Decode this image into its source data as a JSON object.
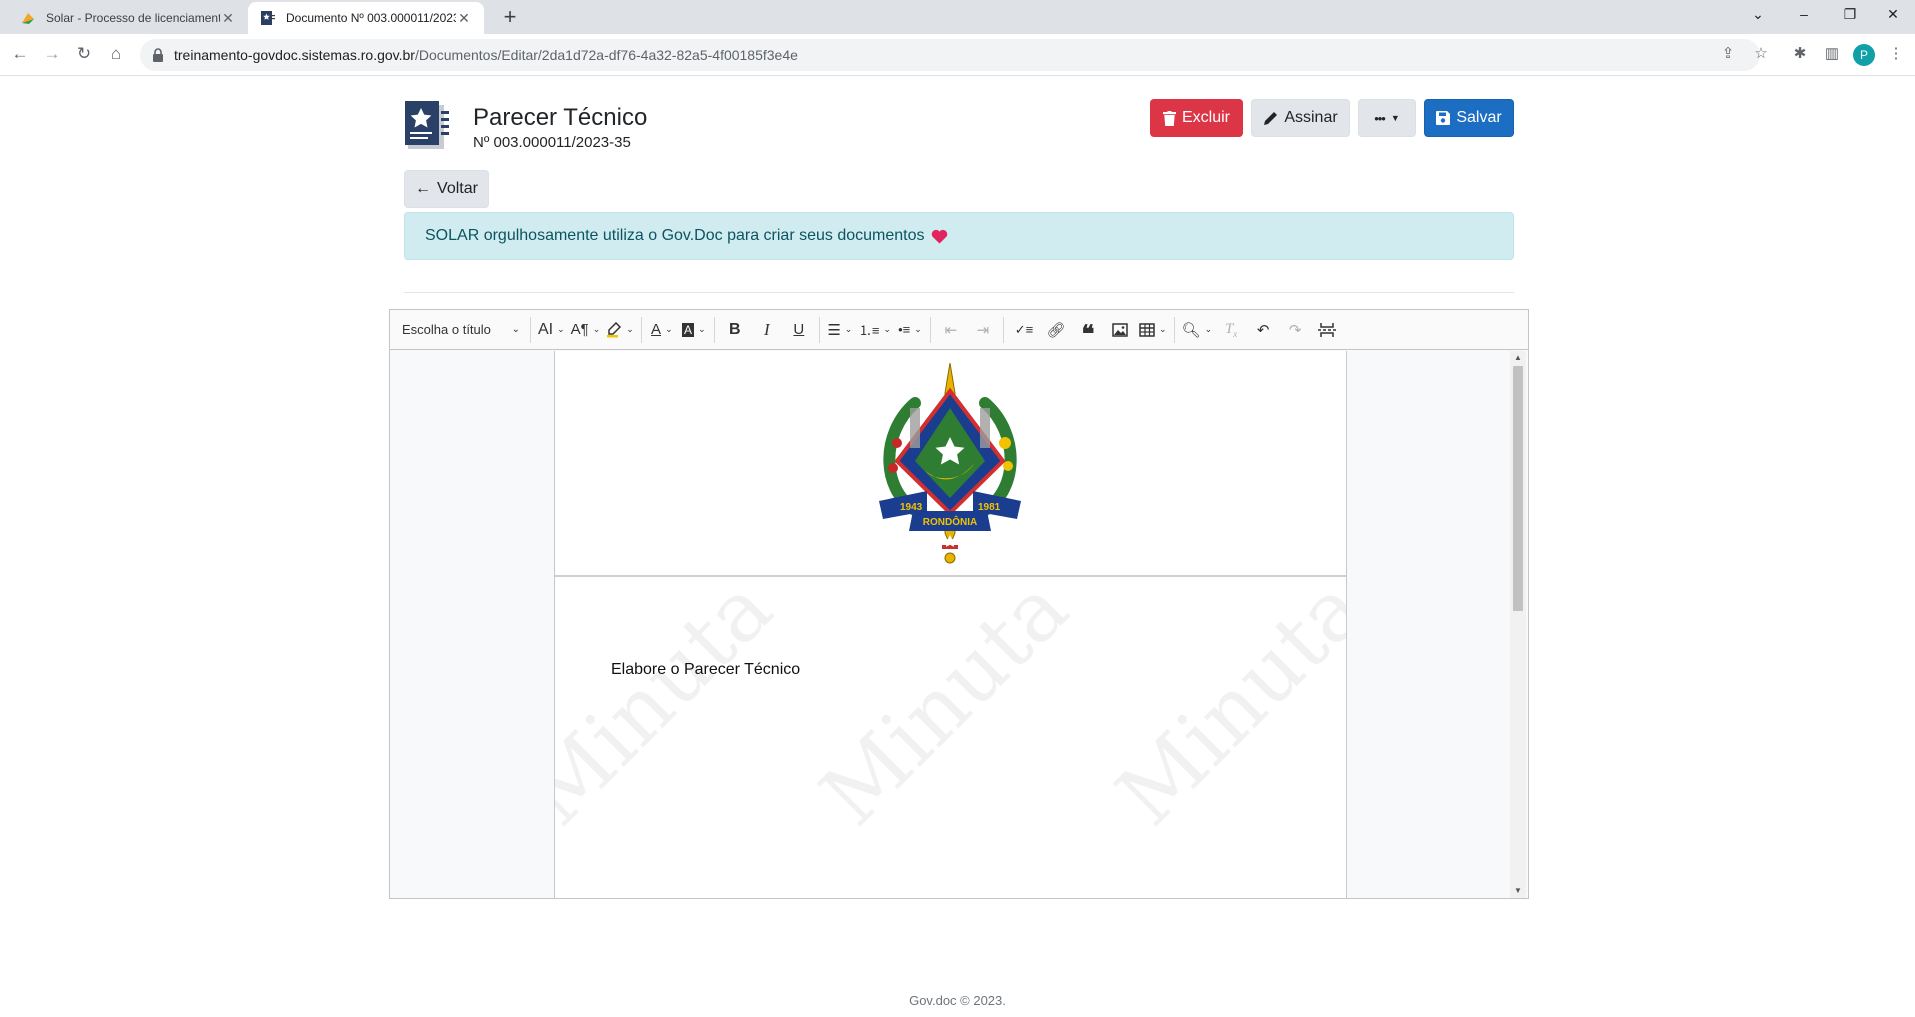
{
  "browser": {
    "tabs": [
      {
        "title": "Solar - Processo de licenciamento",
        "active": false
      },
      {
        "title": "Documento Nº 003.000011/2023-35",
        "active": true
      }
    ],
    "url_host": "treinamento-govdoc.sistemas.ro.gov.br",
    "url_path": "/Documentos/Editar/2da1d72a-df76-4a32-82a5-4f00185f3e4e",
    "profile_initial": "P"
  },
  "header": {
    "title": "Parecer Técnico",
    "number": "Nº 003.000011/2023-35"
  },
  "actions": {
    "delete_label": "Excluir",
    "sign_label": "Assinar",
    "more_label": "•••",
    "save_label": "Salvar",
    "back_label": "Voltar"
  },
  "alert": {
    "text": "SOLAR orgulhosamente utiliza o Gov.Doc para criar seus documentos"
  },
  "editor": {
    "heading_select": "Escolha o título",
    "body_text": "Elabore o Parecer Técnico",
    "watermark": "Minuta",
    "crest": {
      "year_left": "1943",
      "year_right": "1981",
      "banner": "RONDÔNIA"
    }
  },
  "footer": {
    "text": "Gov.doc © 2023."
  },
  "colors": {
    "danger": "#dc3545",
    "primary": "#1b6ec2",
    "alert_bg": "#d1ecf1",
    "alert_text": "#0c5460"
  }
}
